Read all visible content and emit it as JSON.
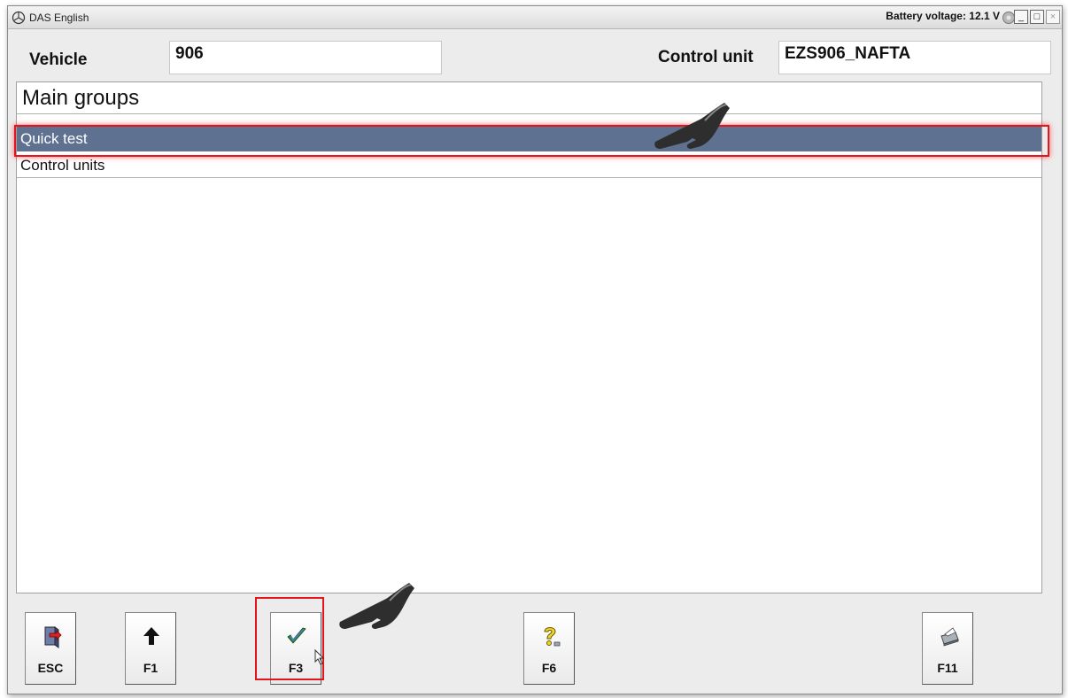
{
  "window": {
    "title": "DAS English",
    "battery": "Battery voltage: 12.1 V",
    "min_btn": "_",
    "max_btn": "□",
    "close_btn": "×"
  },
  "header": {
    "vehicle_label": "Vehicle",
    "vehicle_value": "906",
    "control_unit_label": "Control unit",
    "control_unit_value": "EZS906_NAFTA"
  },
  "list": {
    "group_title": "Main groups",
    "items": [
      "Quick test",
      "Control units"
    ],
    "selected": "Quick test"
  },
  "fkeys": [
    {
      "label": "ESC",
      "icon": "exit-door-icon"
    },
    {
      "label": "F1",
      "icon": "arrow-up-icon"
    },
    {
      "label": "F3",
      "icon": "checkmark-icon"
    },
    {
      "label": "F6",
      "icon": "help-question-icon"
    },
    {
      "label": "F11",
      "icon": "printer-icon"
    }
  ],
  "colors": {
    "selection": "#5f7191",
    "highlight": "#e3141c",
    "checkmark": "#2a8a1f"
  }
}
